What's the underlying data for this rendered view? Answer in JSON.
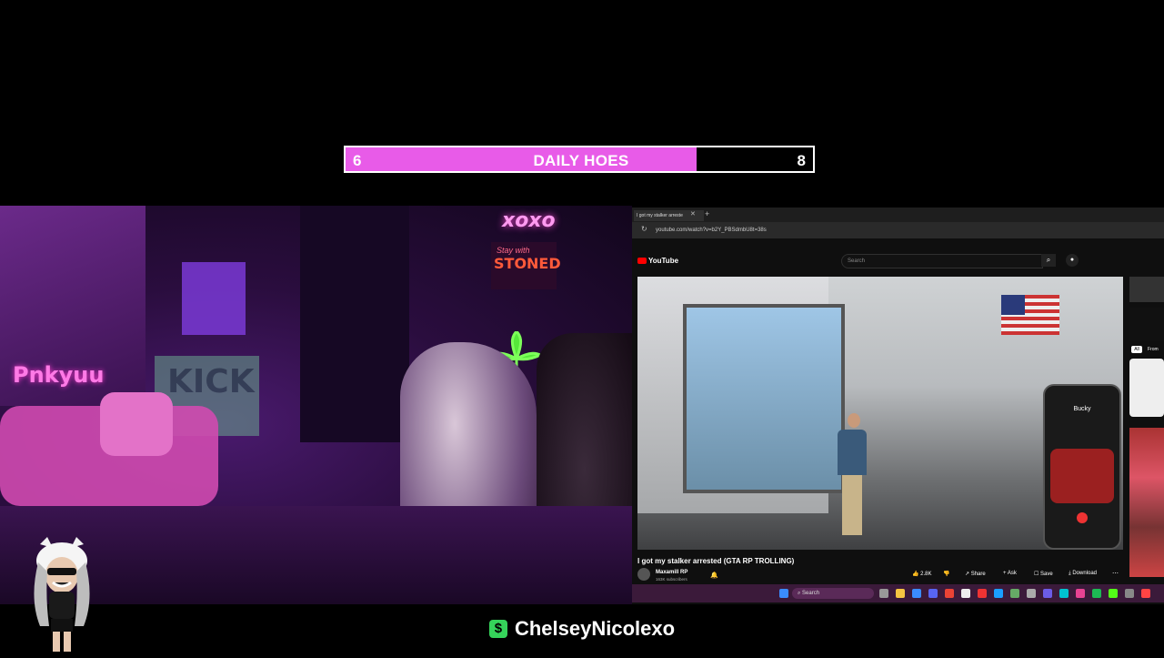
{
  "goal": {
    "current": "6",
    "title": "DAILY HOES",
    "target": "8",
    "progress_fraction": 0.75
  },
  "webcam": {
    "neon_signs": [
      "xoxo",
      "STONED",
      "KICK",
      "Pnkyuu"
    ],
    "sign_prefix": "Stay with"
  },
  "browser": {
    "tab_title": "I got my stalker arreste",
    "url": "youtube.com/watch?v=b2Y_PBSdmbU8t=38s",
    "logo": "YouTube",
    "search_placeholder": "Search",
    "video_title": "I got my stalker arrested (GTA RP TROLLING)",
    "channel_name": "Maxamill RP",
    "subscribers": "163K subscribers",
    "likes": "2.8K",
    "actions": [
      "Share",
      "Ask",
      "Save",
      "Download"
    ],
    "phone_contact": "Bucky",
    "sidebar_chip": "All",
    "sidebar_chip2": "From"
  },
  "taskbar": {
    "search_placeholder": "Search"
  },
  "streamer": {
    "handle": "ChelseyNicolexo"
  },
  "colors": {
    "accent": "#e85be8",
    "kick_green": "#35d35a",
    "taskbar": "#3b1a3a"
  }
}
